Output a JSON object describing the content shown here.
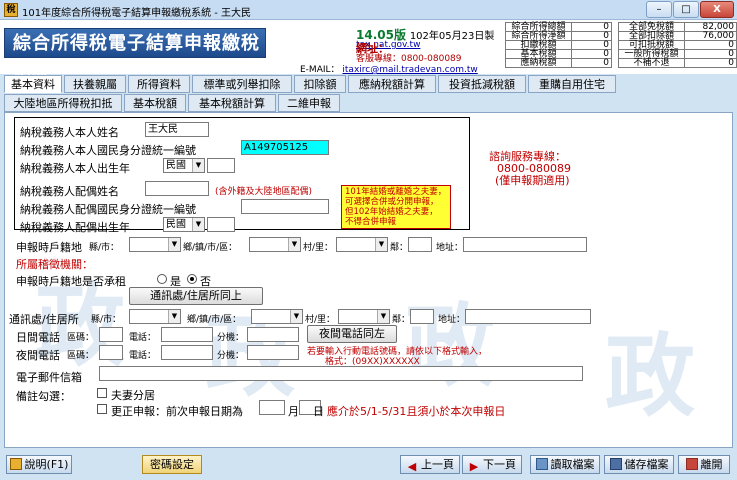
{
  "window": {
    "title": "101年度綜合所得稅電子結算申報繳稅系統 - 王大民",
    "app_icon": "稅",
    "minimize": "–",
    "maximize": "□",
    "close": "X"
  },
  "header": {
    "logo_text": "綜合所得稅電子結算申報繳稅系統",
    "version_num": "14.05版",
    "version_date": "102年05月23日製",
    "website_label": "網址：",
    "website_url": "tax.nat.gov.tw",
    "service_line": "客服專線：0800-080089",
    "email_label": "E-MAIL：",
    "email": "itaxirc@mail.tradevan.com.tw"
  },
  "summary": {
    "left": [
      {
        "k": "綜合所得總額",
        "v": "0"
      },
      {
        "k": "綜合所得淨額",
        "v": "0"
      },
      {
        "k": "扣繳稅額",
        "v": "0"
      },
      {
        "k": "基本稅額",
        "v": "0"
      },
      {
        "k": "應納稅額",
        "v": "0"
      }
    ],
    "right": [
      {
        "k": "全部免稅額",
        "v": "82,000"
      },
      {
        "k": "全部扣除額",
        "v": "76,000"
      },
      {
        "k": "可扣抵稅額",
        "v": "0"
      },
      {
        "k": "一般所得稅額",
        "v": "0"
      },
      {
        "k": "不補不退",
        "v": "0"
      }
    ]
  },
  "tabs_row1": [
    "基本資料",
    "扶養親屬",
    "所得資料",
    "標準或列舉扣除",
    "扣除額",
    "應納稅額計算",
    "投資抵減稅額",
    "重購自用住宅"
  ],
  "tabs_row2": [
    "大陸地區所得稅扣抵",
    "基本稅額",
    "基本稅額計算",
    "二維申報"
  ],
  "form": {
    "taxpayer_name_label": "納稅義務人本人姓名",
    "taxpayer_name": "王大民",
    "taxpayer_id_label": "納稅義務人本人國民身分證統一編號",
    "taxpayer_id": "A149705125",
    "taxpayer_birth_label": "納稅義務人本人出生年",
    "era_option": "民國",
    "spouse_name_label": "納稅義務人配偶姓名",
    "spouse_name_note": "(含外籍及大陸地區配偶)",
    "spouse_id_label": "納稅義務人配偶國民身分證統一編號",
    "spouse_birth_label": "納稅義務人配偶出生年",
    "notice_lines": [
      "101年結婚或離婚之夫妻，",
      "可選擇合併或分開申報，",
      "但102年始結婚之夫妻，",
      "不得合併申報"
    ],
    "hotline_lines": [
      "諮詢服務專線：",
      "0800-080089",
      "(僅申報期適用)"
    ],
    "reg_addr_label": "申報時戶籍地",
    "county_label": "縣/市：",
    "town_label": "鄉/鎮/市/區：",
    "village_label": "村/里：",
    "neighbor_label": "鄰：",
    "address_label": "地址：",
    "tax_office_label": "所屬稽徵機關：",
    "rent_question": "申報時戶籍地是否承租",
    "yes": "是",
    "no": "否",
    "same_addr_button": "通訊處/住居所同上",
    "mail_addr_label": "通訊處/住居所",
    "day_phone_label": "日間電話",
    "night_phone_label": "夜間電話",
    "area_code_label": "區碼：",
    "phone_label": "電話：",
    "ext_label": "分機：",
    "day_phone_same_button": "夜間電話同左",
    "mobile_note_1": "若要輸入行動電話號碼，請依以下格式輸入，",
    "mobile_note_2": "格式：(09XX)XXXXXX",
    "email_label": "電子郵件信箱",
    "remarks_label": "備註勾選：",
    "spouse_separate": "夫妻分居",
    "correction_text": "更正申報：前次申報日期為",
    "month": "月",
    "day": "日",
    "correction_note": "應介於5/1-5/31且須小於本次申報日"
  },
  "watermark": "政",
  "footer": {
    "help": "說明(F1)",
    "password": "密碼設定",
    "prev": "上一頁",
    "next": "下一頁",
    "read": "讀取檔案",
    "save": "儲存檔案",
    "exit": "離開"
  }
}
